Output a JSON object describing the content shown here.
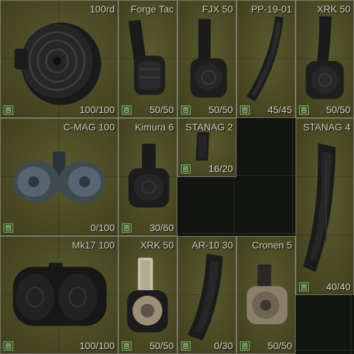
{
  "colors": {
    "cell_background": "#4a4a25",
    "cell_border": "#7d7d69",
    "text": "#d8d8cc",
    "tag_green": "#2e4a22",
    "empty_slot": "#121412"
  },
  "stash": {
    "items": [
      {
        "name": "100rd",
        "count": "100/100",
        "icon": "drum-magazine-icon"
      },
      {
        "name": "Forge Tac",
        "count": "50/50",
        "icon": "drum-magazine-icon"
      },
      {
        "name": "FJX 50",
        "count": "50/50",
        "icon": "drum-magazine-icon"
      },
      {
        "name": "PP-19-01",
        "count": "45/45",
        "icon": "curved-magazine-icon"
      },
      {
        "name": "XRK 50",
        "count": "50/50",
        "icon": "drum-magazine-icon"
      },
      {
        "name": "C-MAG 100",
        "count": "0/100",
        "icon": "twin-drum-magazine-icon"
      },
      {
        "name": "Kimura 6",
        "count": "30/60",
        "icon": "drum-magazine-icon"
      },
      {
        "name": "STANAG 2",
        "count": "16/20",
        "icon": "box-magazine-icon"
      },
      {
        "name": "STANAG 4",
        "count": "40/40",
        "icon": "box-magazine-icon"
      },
      {
        "name": "Mk17 100",
        "count": "100/100",
        "icon": "twin-drum-magazine-icon"
      },
      {
        "name": "XRK 50",
        "count": "50/50",
        "icon": "drum-magazine-icon"
      },
      {
        "name": "AR-10 30",
        "count": "0/30",
        "icon": "curved-magazine-icon"
      },
      {
        "name": "Cronen 5",
        "count": "50/50",
        "icon": "drum-magazine-icon"
      }
    ]
  }
}
